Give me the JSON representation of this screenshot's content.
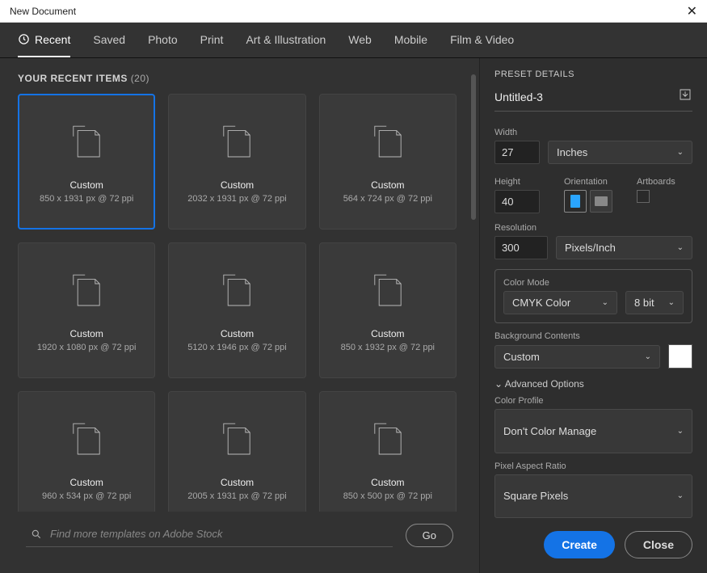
{
  "window": {
    "title": "New Document"
  },
  "tabs": {
    "items": [
      {
        "label": "Recent",
        "active": true,
        "icon": "clock-icon"
      },
      {
        "label": "Saved"
      },
      {
        "label": "Photo"
      },
      {
        "label": "Print"
      },
      {
        "label": "Art & Illustration"
      },
      {
        "label": "Web"
      },
      {
        "label": "Mobile"
      },
      {
        "label": "Film & Video"
      }
    ]
  },
  "recent": {
    "header_label": "YOUR RECENT ITEMS",
    "count_label": "(20)",
    "items": [
      {
        "name": "Custom",
        "dims": "850 x 1931 px @ 72 ppi",
        "selected": true
      },
      {
        "name": "Custom",
        "dims": "2032 x 1931 px @ 72 ppi"
      },
      {
        "name": "Custom",
        "dims": "564 x 724 px @ 72 ppi"
      },
      {
        "name": "Custom",
        "dims": "1920 x 1080 px @ 72 ppi"
      },
      {
        "name": "Custom",
        "dims": "5120 x 1946 px @ 72 ppi"
      },
      {
        "name": "Custom",
        "dims": "850 x 1932 px @ 72 ppi"
      },
      {
        "name": "Custom",
        "dims": "960 x 534 px @ 72 ppi"
      },
      {
        "name": "Custom",
        "dims": "2005 x 1931 px @ 72 ppi"
      },
      {
        "name": "Custom",
        "dims": "850 x 500 px @ 72 ppi"
      }
    ]
  },
  "search": {
    "placeholder": "Find more templates on Adobe Stock",
    "go_label": "Go"
  },
  "preset": {
    "title": "PRESET DETAILS",
    "doc_name": "Untitled-3",
    "width_label": "Width",
    "width_value": "27",
    "unit_value": "Inches",
    "height_label": "Height",
    "height_value": "40",
    "orientation_label": "Orientation",
    "artboards_label": "Artboards",
    "resolution_label": "Resolution",
    "resolution_value": "300",
    "resolution_unit": "Pixels/Inch",
    "color_mode_label": "Color Mode",
    "color_mode_value": "CMYK Color",
    "bit_depth": "8 bit",
    "background_label": "Background Contents",
    "background_value": "Custom",
    "background_swatch": "#ffffff",
    "advanced_label": "Advanced Options",
    "color_profile_label": "Color Profile",
    "color_profile_value": "Don't Color Manage",
    "pixel_aspect_label": "Pixel Aspect Ratio",
    "pixel_aspect_value": "Square Pixels"
  },
  "footer": {
    "create_label": "Create",
    "close_label": "Close"
  }
}
